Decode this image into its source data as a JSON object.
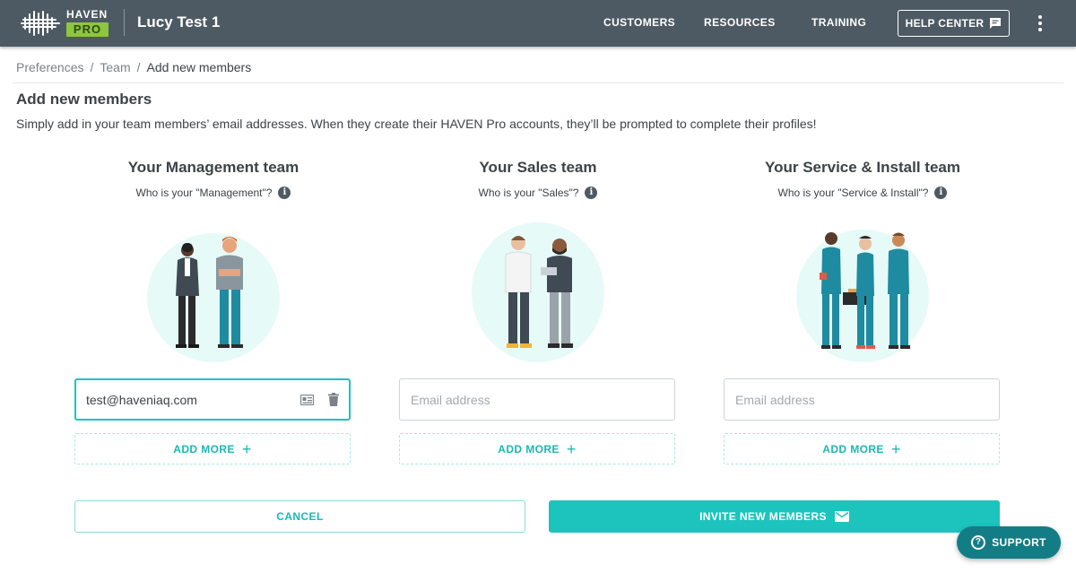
{
  "header": {
    "logo_text": "HAVEN",
    "logo_badge": "PRO",
    "title": "Lucy Test 1",
    "nav": [
      "CUSTOMERS",
      "RESOURCES",
      "TRAINING"
    ],
    "help_label": "HELP CENTER",
    "help_icon": "chat-icon",
    "menu_icon": "kebab-icon"
  },
  "breadcrumb": {
    "items": [
      "Preferences",
      "Team",
      "Add new members"
    ],
    "separator": "/"
  },
  "page": {
    "title": "Add new members",
    "description": "Simply add in your team members’ email addresses. When they create their HAVEN Pro accounts, they’ll be prompted to complete their profiles!"
  },
  "teams": [
    {
      "heading": "Your Management team",
      "question": "Who is your \"Management\"?",
      "email_value": "test@haveniaq.com",
      "email_placeholder": "",
      "add_more": "ADD MORE",
      "plus": "+"
    },
    {
      "heading": "Your Sales team",
      "question": "Who is your \"Sales\"?",
      "email_value": "",
      "email_placeholder": "Email address",
      "add_more": "ADD MORE",
      "plus": "+"
    },
    {
      "heading": "Your Service & Install team",
      "question": "Who is your \"Service & Install\"?",
      "email_value": "",
      "email_placeholder": "Email address",
      "add_more": "ADD MORE",
      "plus": "+"
    }
  ],
  "actions": {
    "cancel": "CANCEL",
    "invite": "INVITE NEW MEMBERS"
  },
  "support": {
    "label": "SUPPORT",
    "icon_glyph": "?"
  },
  "colors": {
    "topbar": "#4e5a63",
    "accent": "#1dc4be",
    "support": "#137d86",
    "logo_badge": "#8dc63f"
  }
}
